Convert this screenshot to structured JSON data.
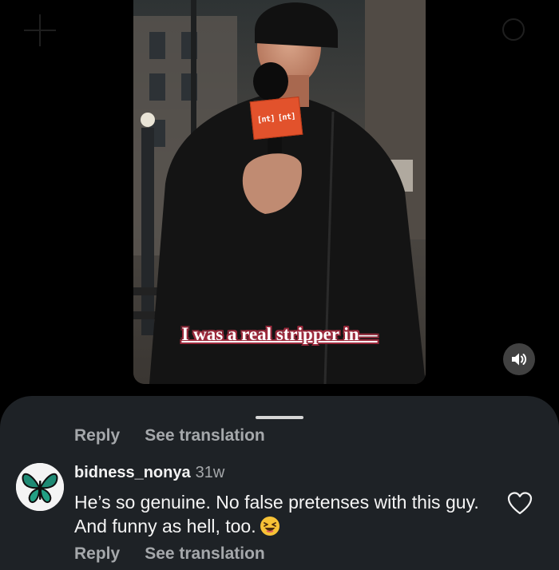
{
  "video": {
    "caption": "I was a real stripper in—",
    "mic_flag_text": [
      "[nt]",
      "[nt]"
    ],
    "sound_icon": "speaker-icon"
  },
  "sheet": {
    "actions_top": {
      "reply": "Reply",
      "translate": "See translation"
    },
    "comment": {
      "avatar_icon": "butterfly-icon",
      "username": "bidness_nonya",
      "age": "31w",
      "text": "He’s so genuine. No false pretenses with this guy. And funny as hell, too.",
      "emoji_icon": "laughing-face-emoji",
      "like_icon": "heart-icon",
      "actions": {
        "reply": "Reply",
        "translate": "See translation"
      }
    }
  },
  "colors": {
    "sheet_bg": "#1e2226",
    "muted_text": "#a5a8ab",
    "caption_outline": "#9b2a3c",
    "mic_flag": "#e2522c"
  }
}
